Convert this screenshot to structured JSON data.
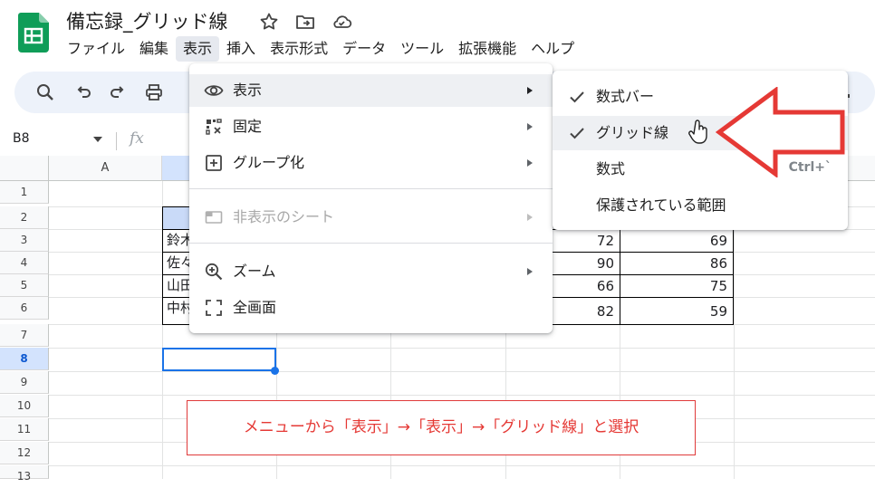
{
  "app": {
    "title": "備忘録_グリッド線"
  },
  "menubar": [
    "ファイル",
    "編集",
    "表示",
    "挿入",
    "表示形式",
    "データ",
    "ツール",
    "拡張機能",
    "ヘルプ"
  ],
  "formula_bar": {
    "cell_ref": "B8",
    "fx": "fx"
  },
  "grid": {
    "column_a": "A",
    "rows": [
      "1",
      "2",
      "3",
      "4",
      "5",
      "6",
      "7",
      "8",
      "9",
      "10",
      "11",
      "12",
      "13"
    ],
    "names": [
      "鈴木",
      "佐々",
      "山田",
      "中村"
    ],
    "col_d": [
      72,
      90,
      66,
      82
    ],
    "col_e": [
      69,
      86,
      75,
      59
    ]
  },
  "view_menu": {
    "items": [
      {
        "label": "表示",
        "icon": "eye-icon"
      },
      {
        "label": "固定",
        "icon": "freeze-grid-icon"
      },
      {
        "label": "グループ化",
        "icon": "plus-box-icon"
      },
      {
        "label": "非表示のシート",
        "icon": "hidden-sheet-icon"
      },
      {
        "label": "ズーム",
        "icon": "zoom-in-icon"
      },
      {
        "label": "全画面",
        "icon": "fullscreen-icon"
      }
    ]
  },
  "show_submenu": {
    "items": [
      {
        "label": "数式バー",
        "checked": true
      },
      {
        "label": "グリッド線",
        "checked": true
      },
      {
        "label": "数式",
        "shortcut": "Ctrl+`"
      },
      {
        "label": "保護されている範囲"
      }
    ]
  },
  "annotation": {
    "text": "メニューから「表示」→「表示」→「グリッド線」と選択",
    "color": "#e53935"
  },
  "colors": {
    "accent": "#1a73e8",
    "sheets_green": "#0f9d58",
    "toolbar_bg": "#edf2fa",
    "arrow_red": "#e53935"
  }
}
